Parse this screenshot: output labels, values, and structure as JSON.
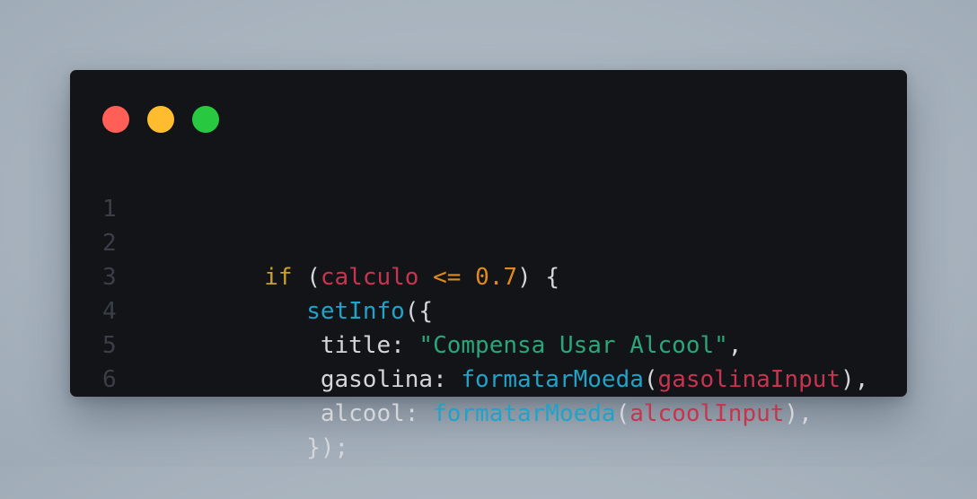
{
  "window": {
    "buttons": [
      {
        "name": "close",
        "color": "#ff5f57"
      },
      {
        "name": "minimize",
        "color": "#febc2e"
      },
      {
        "name": "maximize",
        "color": "#28c840"
      }
    ]
  },
  "colors": {
    "background": "#a8b3be",
    "editor_background": "#121418",
    "line_number": "#3a3f47",
    "default": "#d3d6db",
    "keyword": "#c9a227",
    "variable": "#c7344f",
    "operator": "#e08a1e",
    "number": "#e08a1e",
    "function": "#1fa3c9",
    "string": "#2aa678"
  },
  "code": {
    "lines": [
      {
        "number": "1",
        "tokens": [
          {
            "text": "if",
            "type": "keyword"
          },
          {
            "text": " (",
            "type": "default"
          },
          {
            "text": "calculo",
            "type": "variable"
          },
          {
            "text": " ",
            "type": "default"
          },
          {
            "text": "<=",
            "type": "operator"
          },
          {
            "text": " ",
            "type": "default"
          },
          {
            "text": "0.7",
            "type": "number"
          },
          {
            "text": ") {",
            "type": "default"
          }
        ]
      },
      {
        "number": "2",
        "tokens": [
          {
            "text": "   ",
            "type": "default"
          },
          {
            "text": "setInfo",
            "type": "function"
          },
          {
            "text": "({",
            "type": "default"
          }
        ]
      },
      {
        "number": "3",
        "tokens": [
          {
            "text": "    title: ",
            "type": "default"
          },
          {
            "text": "\"Compensa Usar Alcool\"",
            "type": "string"
          },
          {
            "text": ",",
            "type": "default"
          }
        ]
      },
      {
        "number": "4",
        "tokens": [
          {
            "text": "    gasolina: ",
            "type": "default"
          },
          {
            "text": "formatarMoeda",
            "type": "function"
          },
          {
            "text": "(",
            "type": "default"
          },
          {
            "text": "gasolinaInput",
            "type": "variable"
          },
          {
            "text": "),",
            "type": "default"
          }
        ]
      },
      {
        "number": "5",
        "tokens": [
          {
            "text": "    alcool: ",
            "type": "default"
          },
          {
            "text": "formatarMoeda",
            "type": "function"
          },
          {
            "text": "(",
            "type": "default"
          },
          {
            "text": "alcoolInput",
            "type": "variable"
          },
          {
            "text": "),",
            "type": "default"
          }
        ]
      },
      {
        "number": "6",
        "tokens": [
          {
            "text": "   });",
            "type": "default"
          }
        ]
      }
    ]
  }
}
